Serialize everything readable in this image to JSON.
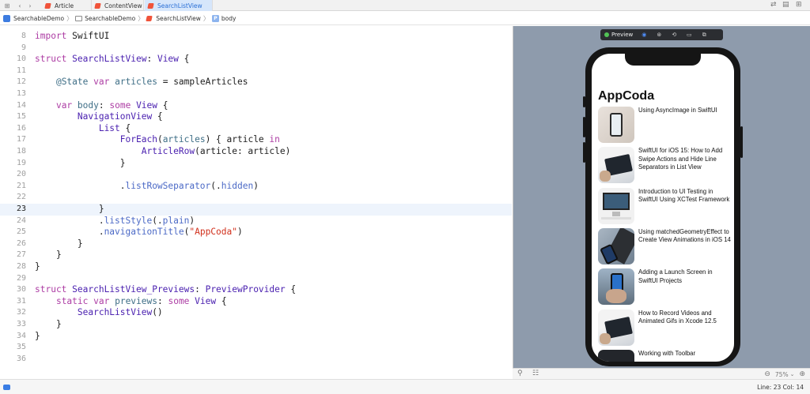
{
  "tabs": [
    {
      "label": "Article",
      "active": false
    },
    {
      "label": "ContentView",
      "active": false
    },
    {
      "label": "SearchListView",
      "active": true
    }
  ],
  "breadcrumb": {
    "project": "SearchableDemo",
    "folder": "SearchableDemo",
    "file": "SearchListView",
    "symbol": "body"
  },
  "icons": {
    "grid": "grid-icon",
    "back": "chevron-left-icon",
    "forward": "chevron-right-icon",
    "swap": "swap-icon",
    "split": "split-editor-icon"
  },
  "colors": {
    "keyword": "#ad3da4",
    "type": "#4b21b0",
    "attribute": "#3e6e86",
    "string": "#d12f1b",
    "member": "#4b69c6",
    "current_line": "#eef4fc",
    "preview_bg": "#8e9bac"
  },
  "code_lines": [
    {
      "num": "8",
      "tokens": [
        [
          "kw",
          "import"
        ],
        [
          "t",
          " SwiftUI"
        ]
      ]
    },
    {
      "num": "9",
      "tokens": []
    },
    {
      "num": "10",
      "tokens": [
        [
          "kw",
          "struct"
        ],
        [
          "t",
          " "
        ],
        [
          "ty",
          "SearchListView"
        ],
        [
          "t",
          ": "
        ],
        [
          "ty",
          "View"
        ],
        [
          "t",
          " {"
        ]
      ]
    },
    {
      "num": "11",
      "tokens": []
    },
    {
      "num": "12",
      "tokens": [
        [
          "t",
          "    "
        ],
        [
          "at",
          "@State"
        ],
        [
          "t",
          " "
        ],
        [
          "kw",
          "var"
        ],
        [
          "t",
          " "
        ],
        [
          "pr",
          "articles"
        ],
        [
          "t",
          " = sampleArticles"
        ]
      ]
    },
    {
      "num": "13",
      "tokens": []
    },
    {
      "num": "14",
      "tokens": [
        [
          "t",
          "    "
        ],
        [
          "kw",
          "var"
        ],
        [
          "t",
          " "
        ],
        [
          "pr",
          "body"
        ],
        [
          "t",
          ": "
        ],
        [
          "kw",
          "some"
        ],
        [
          "t",
          " "
        ],
        [
          "ty",
          "View"
        ],
        [
          "t",
          " {"
        ]
      ]
    },
    {
      "num": "15",
      "tokens": [
        [
          "t",
          "        "
        ],
        [
          "ty",
          "NavigationView"
        ],
        [
          "t",
          " {"
        ]
      ]
    },
    {
      "num": "16",
      "tokens": [
        [
          "t",
          "            "
        ],
        [
          "ty",
          "List"
        ],
        [
          "t",
          " {"
        ]
      ]
    },
    {
      "num": "17",
      "tokens": [
        [
          "t",
          "                "
        ],
        [
          "ty",
          "ForEach"
        ],
        [
          "t",
          "("
        ],
        [
          "pr",
          "articles"
        ],
        [
          "t",
          ") { article "
        ],
        [
          "kw",
          "in"
        ]
      ]
    },
    {
      "num": "18",
      "tokens": [
        [
          "t",
          "                    "
        ],
        [
          "ty",
          "ArticleRow"
        ],
        [
          "t",
          "(article: article)"
        ]
      ]
    },
    {
      "num": "19",
      "tokens": [
        [
          "t",
          "                }"
        ]
      ]
    },
    {
      "num": "20",
      "tokens": []
    },
    {
      "num": "21",
      "tokens": [
        [
          "t",
          "                ."
        ],
        [
          "mem",
          "listRowSeparator"
        ],
        [
          "t",
          "(."
        ],
        [
          "mem",
          "hidden"
        ],
        [
          "t",
          ")"
        ]
      ]
    },
    {
      "num": "22",
      "tokens": []
    },
    {
      "num": "23",
      "tokens": [
        [
          "t",
          "            }"
        ]
      ],
      "current": true
    },
    {
      "num": "24",
      "tokens": [
        [
          "t",
          "            ."
        ],
        [
          "mem",
          "listStyle"
        ],
        [
          "t",
          "(."
        ],
        [
          "mem",
          "plain"
        ],
        [
          "t",
          ")"
        ]
      ]
    },
    {
      "num": "25",
      "tokens": [
        [
          "t",
          "            ."
        ],
        [
          "mem",
          "navigationTitle"
        ],
        [
          "t",
          "("
        ],
        [
          "str",
          "\"AppCoda\""
        ],
        [
          "t",
          ")"
        ]
      ]
    },
    {
      "num": "26",
      "tokens": [
        [
          "t",
          "        }"
        ]
      ]
    },
    {
      "num": "27",
      "tokens": [
        [
          "t",
          "    }"
        ]
      ]
    },
    {
      "num": "28",
      "tokens": [
        [
          "t",
          "}"
        ]
      ]
    },
    {
      "num": "29",
      "tokens": []
    },
    {
      "num": "30",
      "tokens": [
        [
          "kw",
          "struct"
        ],
        [
          "t",
          " "
        ],
        [
          "ty",
          "SearchListView_Previews"
        ],
        [
          "t",
          ": "
        ],
        [
          "ty",
          "PreviewProvider"
        ],
        [
          "t",
          " {"
        ]
      ]
    },
    {
      "num": "31",
      "tokens": [
        [
          "t",
          "    "
        ],
        [
          "kw",
          "static"
        ],
        [
          "t",
          " "
        ],
        [
          "kw",
          "var"
        ],
        [
          "t",
          " "
        ],
        [
          "pr",
          "previews"
        ],
        [
          "t",
          ": "
        ],
        [
          "kw",
          "some"
        ],
        [
          "t",
          " "
        ],
        [
          "ty",
          "View"
        ],
        [
          "t",
          " {"
        ]
      ]
    },
    {
      "num": "32",
      "tokens": [
        [
          "t",
          "        "
        ],
        [
          "ty",
          "SearchListView"
        ],
        [
          "t",
          "()"
        ]
      ]
    },
    {
      "num": "33",
      "tokens": [
        [
          "t",
          "    }"
        ]
      ]
    },
    {
      "num": "34",
      "tokens": [
        [
          "t",
          "}"
        ]
      ]
    },
    {
      "num": "35",
      "tokens": []
    },
    {
      "num": "36",
      "tokens": []
    }
  ],
  "preview": {
    "toolbar_label": "Preview",
    "app_title": "AppCoda",
    "articles": [
      {
        "title": "Using AsyncImage in SwiftUI",
        "thumb": "phone-on-wood"
      },
      {
        "title": "SwiftUI for iOS 15: How to Add Swipe Actions and Hide Line Separators in List View",
        "thumb": "ipad-on-desk"
      },
      {
        "title": "Introduction to UI Testing in SwiftUI Using XCTest Framework",
        "thumb": "imac-desk"
      },
      {
        "title": "Using matchedGeometryEffect to Create View Animations in iOS 14",
        "thumb": "keyboard-phone"
      },
      {
        "title": "Adding a Launch Screen in SwiftUI Projects",
        "thumb": "phone-in-hand"
      },
      {
        "title": "How to Record Videos and Animated Gifs in Xcode 12.5",
        "thumb": "ipad-on-desk"
      },
      {
        "title": "Working with Toolbar",
        "thumb": "dark-device"
      }
    ],
    "zoom": "75%"
  },
  "status": {
    "position": "Line: 23  Col: 14"
  }
}
